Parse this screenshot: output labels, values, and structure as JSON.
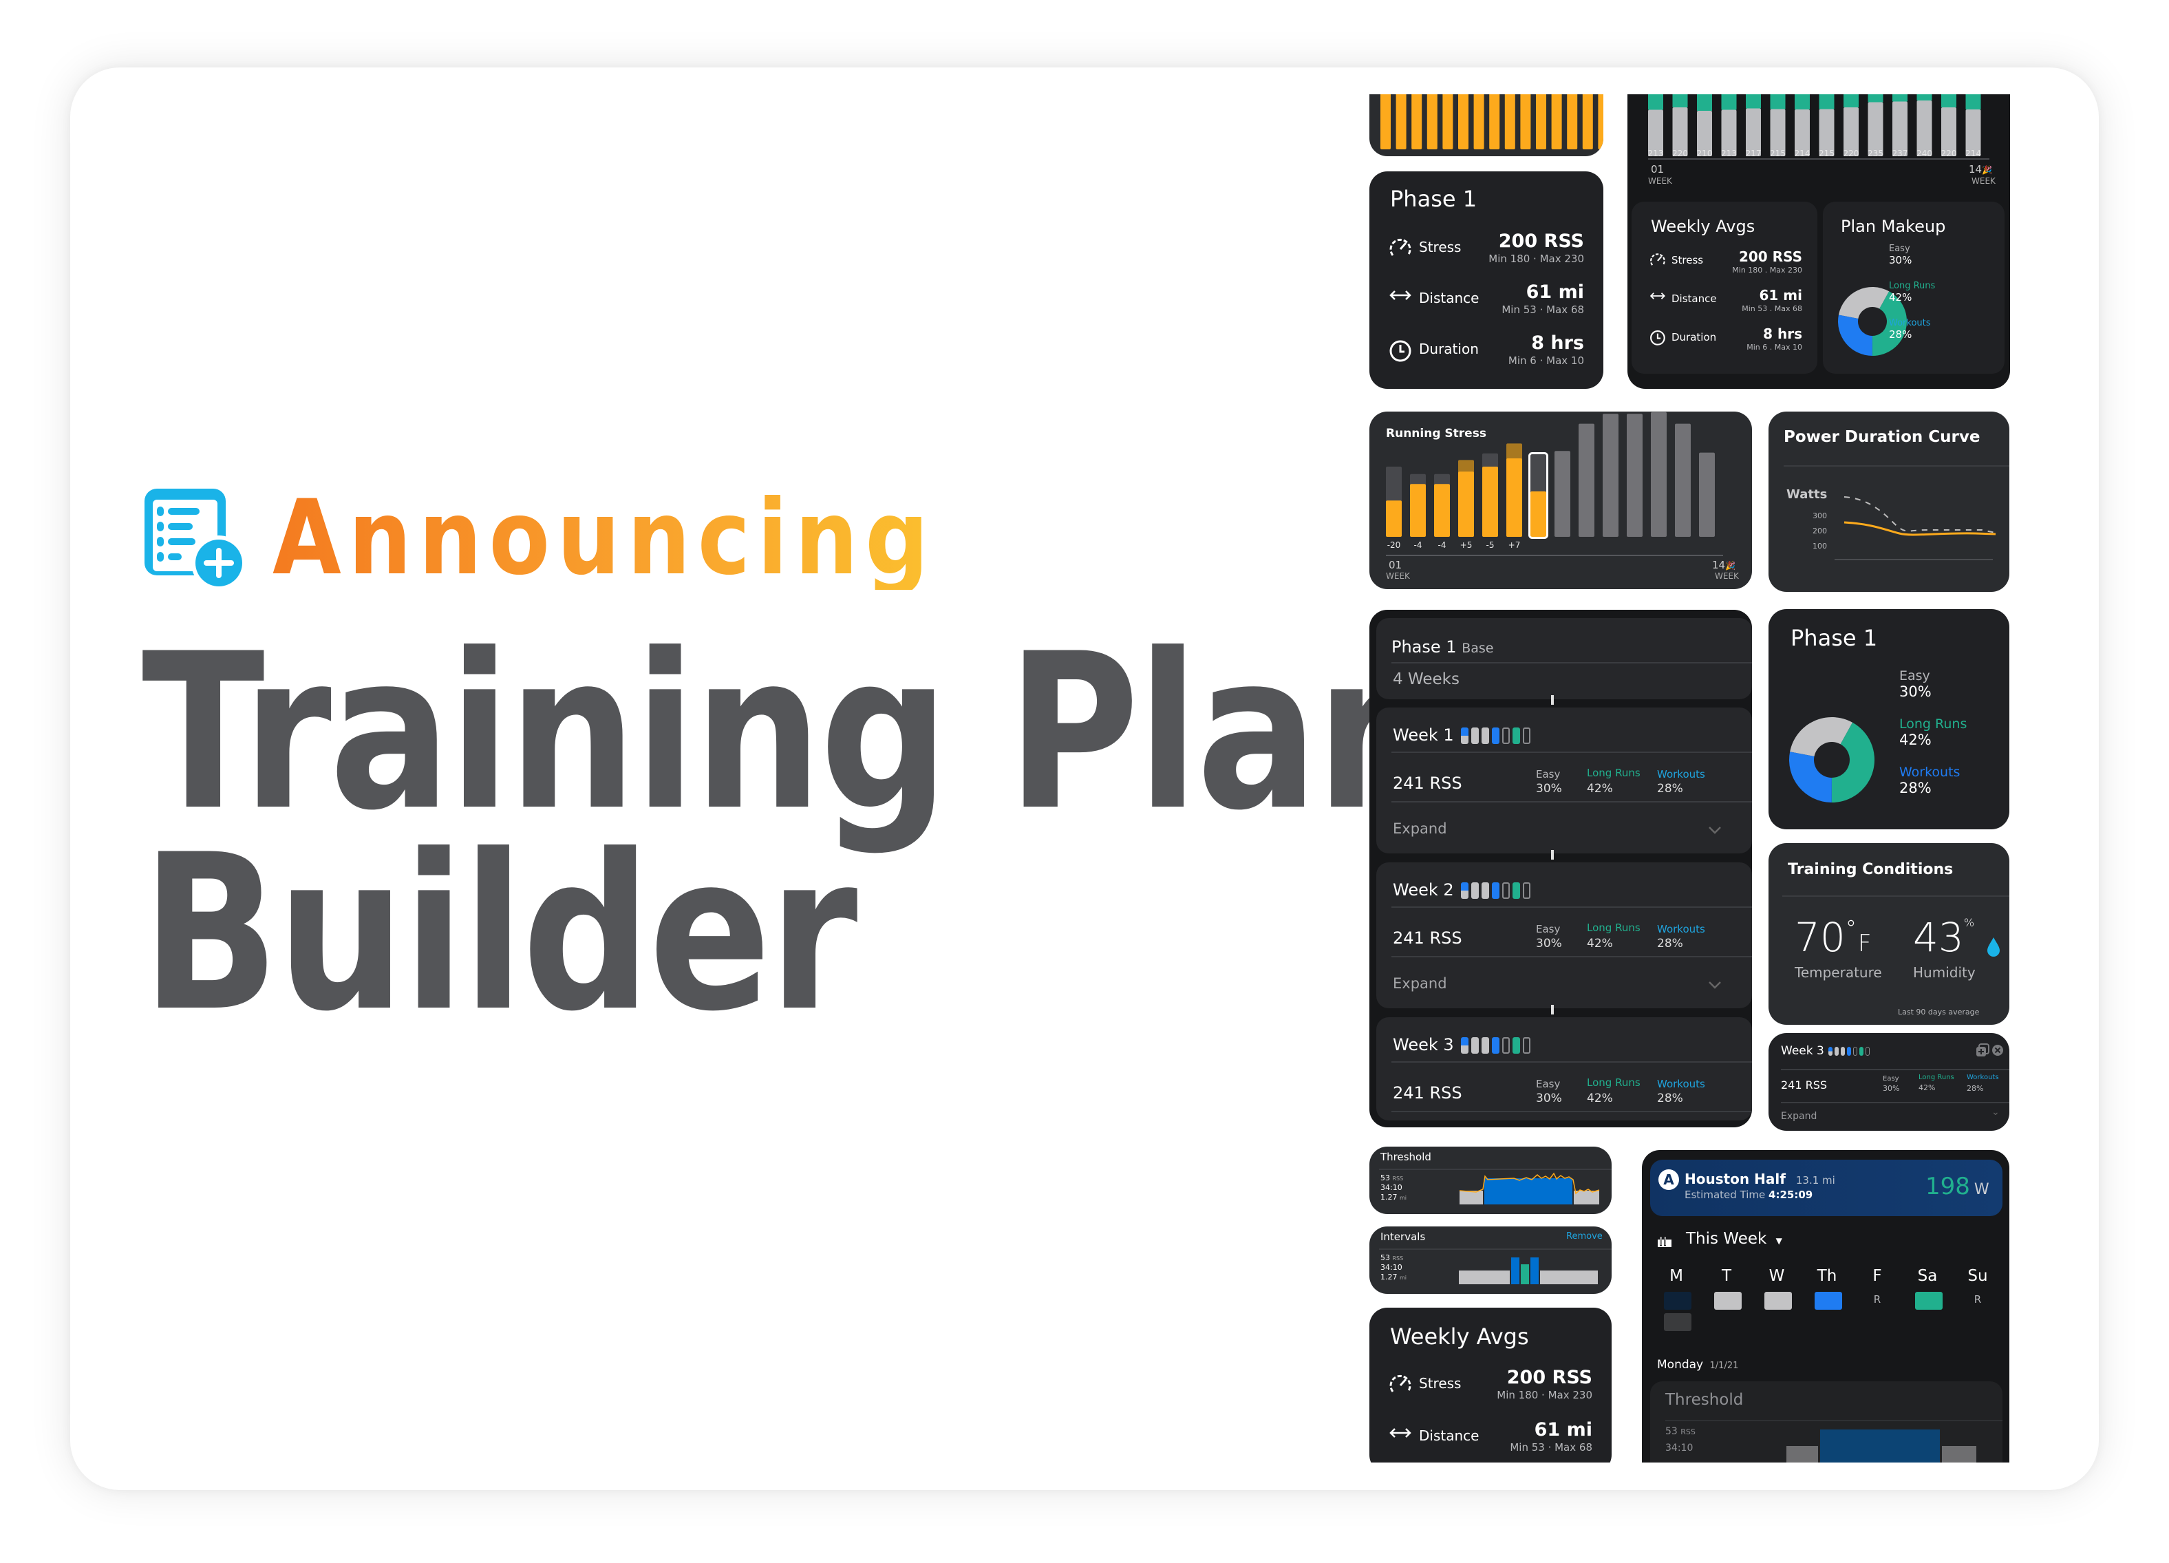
{
  "hero": {
    "announce": "Announcing",
    "title_line1": "Training Plan",
    "title_line2": "Builder",
    "title_color": "#545558",
    "gradient": [
      "#f47b20",
      "#fbbf2f"
    ],
    "icon": "plan-add-icon"
  },
  "colors": {
    "orange": "#fdaa1c",
    "easy": "#c3c3c5",
    "long_runs": "#21b08e",
    "workouts": "#1f7cf2",
    "card_bg": "#202124"
  },
  "phase_card": {
    "title": "Phase 1",
    "rows": [
      {
        "icon": "speedometer-icon",
        "label": "Stress",
        "value": "200 RSS",
        "range": "Min 180 · Max 230"
      },
      {
        "icon": "arrows-horizontal-icon",
        "label": "Distance",
        "value": "61 mi",
        "range": "Min 53 · Max 68"
      },
      {
        "icon": "clock-icon",
        "label": "Duration",
        "value": "8 hrs",
        "range": "Min 6 · Max 10"
      }
    ]
  },
  "plan_chart": {
    "totals": [
      "213",
      "220",
      "210",
      "213",
      "217",
      "215",
      "214",
      "215",
      "220",
      "235",
      "237",
      "240",
      "220",
      "214"
    ],
    "start_week": "01",
    "end_week": "14",
    "week_label": "WEEK"
  },
  "weekly_avgs_small": {
    "title": "Weekly Avgs",
    "rows": [
      {
        "label": "Stress",
        "value": "200 RSS",
        "range": "Min 180 . Max 230"
      },
      {
        "label": "Distance",
        "value": "61 mi",
        "range": "Min 53 . Max 68"
      },
      {
        "label": "Duration",
        "value": "8 hrs",
        "range": "Min 6 . Max 10"
      }
    ]
  },
  "plan_makeup": {
    "title": "Plan Makeup",
    "segments": [
      {
        "label": "Easy",
        "value": "30%",
        "pct": 30
      },
      {
        "label": "Long Runs",
        "value": "42%",
        "pct": 42
      },
      {
        "label": "Workouts",
        "value": "28%",
        "pct": 28
      }
    ]
  },
  "running_stress": {
    "title": "Running Stress",
    "deltas": [
      "-20",
      "-4",
      "-4",
      "+5",
      "-5",
      "+7"
    ],
    "start_week": "01",
    "end_week": "14",
    "week_label": "WEEK"
  },
  "power_curve": {
    "title": "Power Duration Curve",
    "y_label": "Watts",
    "y_ticks": [
      "300",
      "200",
      "100"
    ]
  },
  "phase_detail": {
    "title": "Phase 1",
    "subtitle": "Base",
    "duration": "4 Weeks",
    "weeks": [
      {
        "label": "Week 1",
        "rss": "241 RSS",
        "easy": "30%",
        "long": "42%",
        "workouts": "28%",
        "expand": "Expand"
      },
      {
        "label": "Week 2",
        "rss": "241 RSS",
        "easy": "30%",
        "long": "42%",
        "workouts": "28%",
        "expand": "Expand"
      },
      {
        "label": "Week 3",
        "rss": "241 RSS",
        "easy": "30%",
        "long": "42%",
        "workouts": "28%"
      }
    ],
    "labels": {
      "easy": "Easy",
      "long": "Long Runs",
      "workouts": "Workouts"
    }
  },
  "phase_donut": {
    "title": "Phase 1",
    "segments": [
      {
        "label": "Easy",
        "value": "30%",
        "pct": 30
      },
      {
        "label": "Long Runs",
        "value": "42%",
        "pct": 42
      },
      {
        "label": "Workouts",
        "value": "28%",
        "pct": 28
      }
    ]
  },
  "conditions": {
    "title": "Training Conditions",
    "temp": "70",
    "temp_unit": "°",
    "temp_scale": "F",
    "temp_label": "Temperature",
    "humidity": "43",
    "humidity_unit": "%",
    "humidity_label": "Humidity",
    "footnote": "Last 90 days average"
  },
  "week3_card": {
    "label": "Week 3",
    "rss": "241 RSS",
    "easy_label": "Easy",
    "easy": "30%",
    "long_label": "Long Runs",
    "long": "42%",
    "workouts_label": "Workouts",
    "workouts": "28%",
    "expand": "Expand"
  },
  "threshold_card": {
    "title": "Threshold",
    "rss": "53",
    "rss_unit": "RSS",
    "time": "34:10",
    "dist": "1.27",
    "dist_unit": "mi"
  },
  "intervals_card": {
    "title": "Intervals",
    "remove": "Remove",
    "rss": "53",
    "rss_unit": "RSS",
    "time": "34:10",
    "dist": "1.27",
    "dist_unit": "mi"
  },
  "weekly_avgs_big": {
    "title": "Weekly Avgs",
    "rows": [
      {
        "label": "Stress",
        "value": "200 RSS",
        "range": "Min 180 · Max 230"
      },
      {
        "label": "Distance",
        "value": "61 mi",
        "range": "Min 53 · Max 68"
      }
    ]
  },
  "race_card": {
    "badge": "A",
    "race": "Houston Half",
    "distance": "13.1 mi",
    "est_label": "Estimated Time",
    "est_time": "4:25:09",
    "power": "198",
    "power_unit": "W",
    "period": "This Week",
    "days": [
      {
        "d": "M",
        "mark": ""
      },
      {
        "d": "T",
        "mark": ""
      },
      {
        "d": "W",
        "mark": ""
      },
      {
        "d": "Th",
        "mark": ""
      },
      {
        "d": "F",
        "mark": "R"
      },
      {
        "d": "Sa",
        "mark": ""
      },
      {
        "d": "Su",
        "mark": "R"
      }
    ],
    "day_title": "Monday",
    "day_date": "1/1/21",
    "workout_title": "Threshold",
    "workout_rss": "53",
    "workout_rss_unit": "RSS",
    "workout_time": "34:10"
  }
}
